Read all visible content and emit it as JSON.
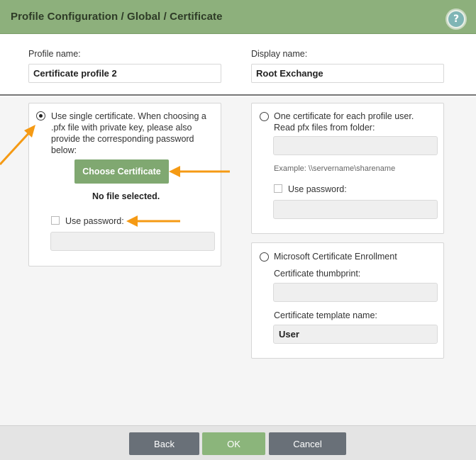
{
  "header": {
    "title": "Profile Configuration / Global / Certificate",
    "help_label": "?"
  },
  "fields": {
    "profile_name_label": "Profile name:",
    "profile_name_value": "Certificate profile 2",
    "display_name_label": "Display name:",
    "display_name_value": "Root Exchange"
  },
  "single_cert": {
    "selected": true,
    "description": "Use single certificate. When choosing a .pfx file with private key, please also provide the corresponding password below:",
    "choose_button": "Choose Certificate",
    "no_file_text": "No file selected.",
    "use_password_label": "Use password:"
  },
  "per_user_cert": {
    "selected": false,
    "description": "One certificate for each profile user. Read pfx files from folder:",
    "example_text": "Example: \\\\servername\\sharename",
    "use_password_label": "Use password:"
  },
  "enrollment": {
    "selected": false,
    "title": "Microsoft Certificate Enrollment",
    "thumbprint_label": "Certificate thumbprint:",
    "template_label": "Certificate template name:",
    "template_value": "User"
  },
  "footer": {
    "back": "Back",
    "ok": "OK",
    "cancel": "Cancel"
  },
  "colors": {
    "header": "#8db07c",
    "accent_button": "#80a871",
    "ok_button": "#8bb57b",
    "neutral_button": "#697078",
    "annotation_arrow": "#f59a14"
  }
}
